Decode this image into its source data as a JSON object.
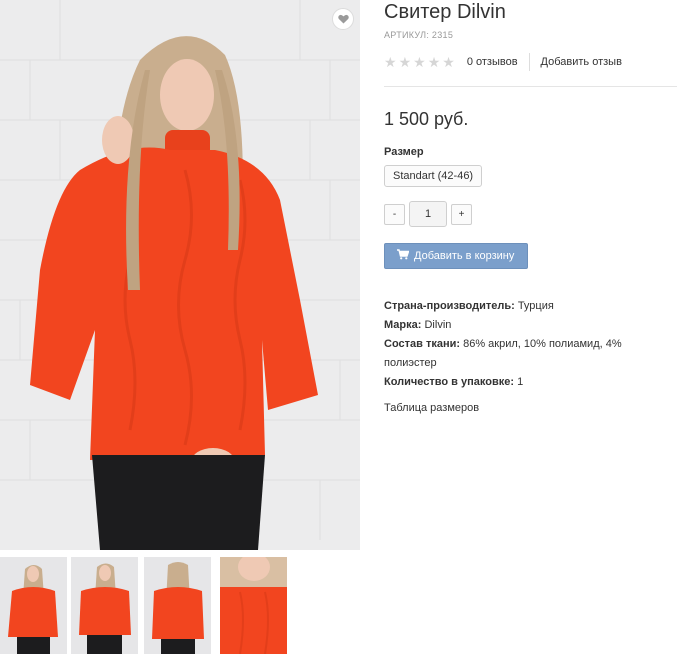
{
  "product": {
    "title": "Свитер Dilvin",
    "sku": "АРТИКУЛ: 2315",
    "reviews_count": "0 отзывов",
    "add_review": "Добавить отзыв",
    "rating_stars": 5,
    "price": "1 500 руб.",
    "size_label": "Размер",
    "size_option": "Standart (42-46)",
    "quantity": "1",
    "qty_minus": "-",
    "qty_plus": "+",
    "add_to_cart": "Добавить в корзину",
    "properties": [
      {
        "name": "Страна-производитель:",
        "value": "Турция"
      },
      {
        "name": "Марка:",
        "value": "Dilvin"
      },
      {
        "name": "Состав ткани:",
        "value": "86% акрил, 10% полиамид, 4% полиэстер"
      },
      {
        "name": "Количество в упаковке:",
        "value": "1"
      }
    ],
    "size_table_link": "Таблица размеров"
  },
  "icons": {
    "wishlist": "heart-icon",
    "cart": "cart-icon",
    "star": "star-icon"
  },
  "colors": {
    "sweater": "#f2451f",
    "cart_button": "#7b9fcb",
    "star": "#d6d6d6"
  }
}
